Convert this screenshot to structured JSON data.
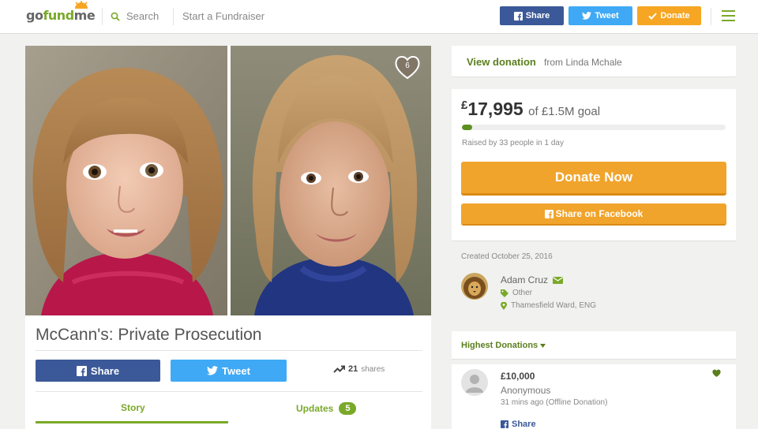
{
  "header": {
    "logo_part1": "go",
    "logo_part2": "fund",
    "logo_part3": "me",
    "search_label": "Search",
    "start_label": "Start a Fundraiser",
    "share_label": "Share",
    "tweet_label": "Tweet",
    "donate_label": "Donate"
  },
  "campaign": {
    "photo_count": "6",
    "title": "McCann's: Private Prosecution",
    "share_label": "Share",
    "tweet_label": "Tweet",
    "shares_count": "21",
    "shares_label": "shares",
    "tabs": {
      "story": "Story",
      "updates": "Updates",
      "updates_count": "5"
    }
  },
  "view_donation": {
    "label": "View donation",
    "from": "from Linda Mchale"
  },
  "progress": {
    "currency": "£",
    "raised": "17,995",
    "goal_text": "of £1.5M goal",
    "raised_fraction": 0.012,
    "raised_by": "Raised by 33 people in 1 day",
    "donate_now": "Donate Now",
    "share_facebook": "Share on Facebook"
  },
  "organizer": {
    "created": "Created October 25, 2016",
    "name": "Adam Cruz",
    "category": "Other",
    "location": "Thamesfield Ward, ENG"
  },
  "highest_donations": {
    "label": "Highest Donations",
    "items": [
      {
        "amount": "£10,000",
        "name": "Anonymous",
        "time": "31 mins ago (Offline Donation)",
        "share_label": "Share"
      }
    ]
  },
  "colors": {
    "brand_green": "#7aa929",
    "facebook": "#3b5998",
    "twitter": "#3fa9f5",
    "donate_orange": "#f1a42b"
  }
}
